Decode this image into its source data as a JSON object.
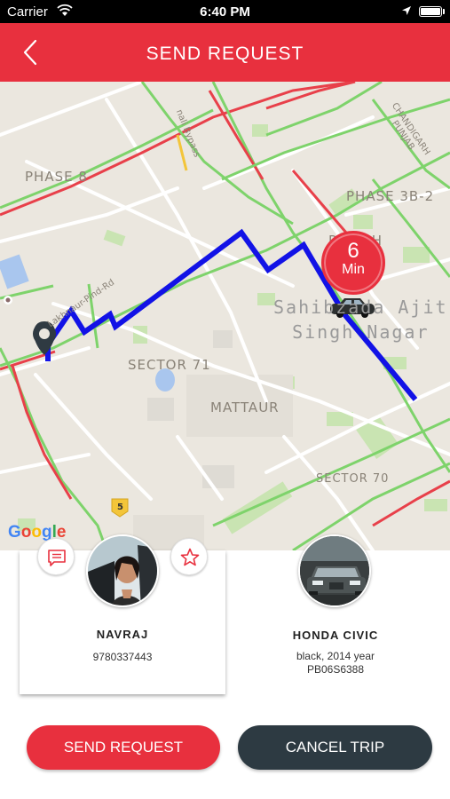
{
  "status_bar": {
    "carrier": "Carrier",
    "time": "6:40 PM"
  },
  "header": {
    "title": "SEND REQUEST"
  },
  "map": {
    "labels": {
      "phase8": "PHASE 8",
      "phase3b2": "PHASE 3B-2",
      "phasekh": "P    K-H",
      "sector71": "SECTOR 71",
      "mattaur": "MATTAUR",
      "sector70": "SECTOR 70",
      "sahibzada_line1": "Sahibzada Ajit",
      "sahibzada_line2": "Singh Nagar"
    },
    "road_labels": {
      "bypass": "nali Bypass",
      "lakhnaur": "Lakhnaur-Pind-Rd",
      "chandigarh": "CHANDIGARH",
      "punjab": "PUNJAB",
      "road5": "5"
    },
    "eta": {
      "value": "6",
      "unit": "Min"
    },
    "google": [
      "G",
      "o",
      "o",
      "g",
      "l",
      "e"
    ],
    "colors": {
      "route": "#1212e6",
      "traffic_green": "#7ed36b",
      "traffic_red": "#e8404a",
      "traffic_yellow": "#f3c53a"
    }
  },
  "driver": {
    "name": "NAVRAJ",
    "phone": "9780337443"
  },
  "car": {
    "model": "HONDA CIVIC",
    "details": "black, 2014 year",
    "plate": "PB06S6388"
  },
  "actions": {
    "send": "SEND REQUEST",
    "cancel": "CANCEL TRIP"
  },
  "icons": {
    "back": "chevron-left-icon",
    "chat": "chat-icon",
    "star": "star-icon",
    "marker": "location-pin-icon",
    "car": "car-icon"
  },
  "colors": {
    "primary": "#e8303e",
    "dark": "#2d3a42"
  }
}
